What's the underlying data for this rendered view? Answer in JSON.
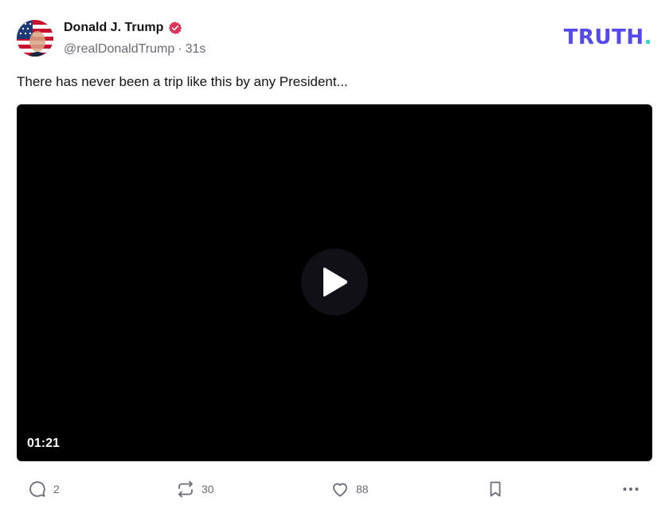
{
  "author": {
    "name": "Donald J. Trump",
    "handle": "@realDonaldTrump",
    "separator": "·",
    "timestamp": "31s",
    "verified": true,
    "avatar_icon": "flag-portrait-avatar"
  },
  "brand": {
    "text": "TRUTH",
    "period": ".",
    "color": "#5448ee",
    "accent_color": "#2ed4c6"
  },
  "post": {
    "text": "There has never been a trip like this by any President..."
  },
  "video": {
    "duration": "01:21",
    "play_icon": "play-icon"
  },
  "actions": {
    "reply_count": "2",
    "retruth_count": "30",
    "like_count": "88",
    "icons": [
      "reply-icon",
      "retruth-icon",
      "like-icon",
      "bookmark-icon",
      "more-icon"
    ]
  },
  "colors": {
    "verified_badge": "#e1325a",
    "muted_text": "#6b6b78"
  }
}
